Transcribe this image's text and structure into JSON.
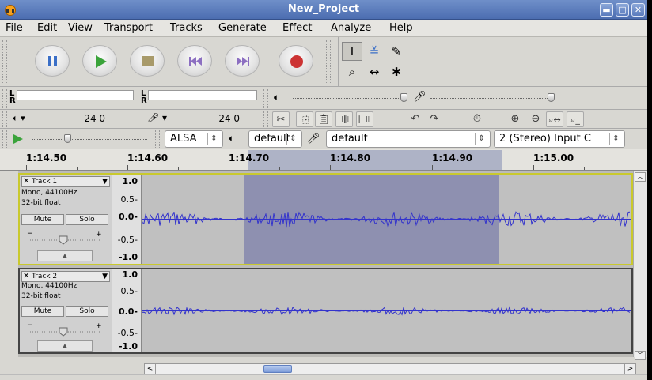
{
  "window": {
    "title": "New_Project",
    "controls": {
      "minimize": "▬",
      "maximize": "□",
      "close": "✕"
    }
  },
  "menu": [
    "File",
    "Edit",
    "View",
    "Transport",
    "Tracks",
    "Generate",
    "Effect",
    "Analyze",
    "Help"
  ],
  "transport": {
    "buttons": [
      "pause-icon",
      "play-icon",
      "stop-icon",
      "skip-start-icon",
      "skip-end-icon",
      "record-icon"
    ],
    "colors": {
      "pause": "#3b6fc7",
      "play": "#3aa33a",
      "stop": "#a89a6a",
      "skip": "#8c6fc1",
      "record": "#cc3333"
    }
  },
  "tools": {
    "items": [
      "selection-tool-icon",
      "envelope-tool-icon",
      "draw-tool-icon",
      "zoom-tool-icon",
      "timeshift-tool-icon",
      "multi-tool-icon"
    ],
    "glyphs": [
      "I",
      "≚",
      "✎",
      "⌕",
      "↔",
      "✱"
    ]
  },
  "meters": {
    "L": "L",
    "R": "R",
    "playback_db": "-24 0",
    "record_db": "-24 0"
  },
  "device_bar": {
    "host": "ALSA",
    "output_device": "default",
    "input_device": "default",
    "input_channels": "2 (Stereo) Input C"
  },
  "ruler": {
    "labels": [
      "1:14.50",
      "1:14.60",
      "1:14.70",
      "1:14.80",
      "1:14.90",
      "1:15.00"
    ]
  },
  "tracks": [
    {
      "name": "Track 1",
      "rate": "Mono, 44100Hz",
      "format": "32-bit float",
      "mute": "Mute",
      "solo": "Solo",
      "selected": true,
      "scale": [
        "1.0",
        "0.5-",
        "0.0-",
        "-0.5-",
        "-1.0"
      ],
      "wave_color": "#3333cc"
    },
    {
      "name": "Track 2",
      "rate": "Mono, 44100Hz",
      "format": "32-bit float",
      "mute": "Mute",
      "solo": "Solo",
      "selected": false,
      "scale": [
        "1.0",
        "0.5-",
        "0.0-",
        "-0.5-",
        "-1.0"
      ],
      "wave_color": "#3333cc"
    }
  ],
  "colors": {
    "selection": "#8e90b0",
    "titlebar": "#5a7bbd"
  }
}
